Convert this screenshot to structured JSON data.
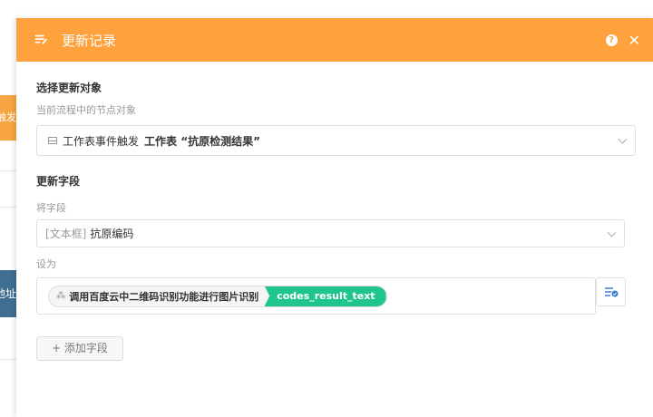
{
  "background": {
    "orange_item": "触发",
    "blue_item": "地址"
  },
  "header": {
    "title": "更新记录",
    "help_icon": "question-circle-icon",
    "close_icon": "close-icon"
  },
  "target": {
    "section_label": "选择更新对象",
    "hint": "当前流程中的节点对象",
    "selected_prefix": "工作表事件触发",
    "selected_value": "工作表 “抗原检测结果”"
  },
  "fields": {
    "section_label": "更新字段",
    "field_label": "将字段",
    "field_type": "[文本框]",
    "field_name": "抗原编码",
    "set_label": "设为",
    "node_name": "调用百度云中二维码识别功能进行图片识别",
    "node_field": "codes_result_text"
  },
  "add_field_label": "+ 添加字段",
  "colors": {
    "header": "#ffa23e",
    "tag": "#1fc58a"
  }
}
